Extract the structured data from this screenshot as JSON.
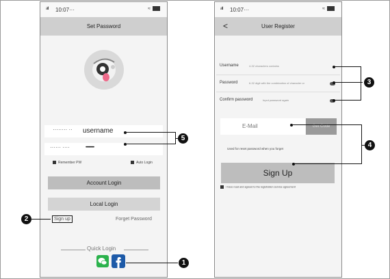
{
  "left_screen": {
    "status": {
      "signal": "atl",
      "time": "10:07···",
      "icons": "≈"
    },
    "title": "Set Password",
    "username_dots": "········ ··",
    "username": "username",
    "password_dots": "······ ····",
    "password_value": "•••••••••••",
    "remember_pw": "Remember PW",
    "auto_login": "Auto Login",
    "account_login": "Account Login",
    "local_login": "Local Login",
    "sign_up": "Sign up",
    "forget_password": "Forget Password",
    "quick_login": "Quick Login",
    "wechat_icon_name": "wechat-icon",
    "facebook_icon_name": "facebook-icon"
  },
  "right_screen": {
    "status": {
      "signal": "atl",
      "time": "10:07···",
      "icons": "≈"
    },
    "back": "<",
    "title": "User Register",
    "username_label": "Username",
    "username_ph": "4-32 characters contains",
    "password_label": "Password",
    "password_ph": "6-32 digit with the combination of character or",
    "confirm_label": "Confirm password",
    "confirm_ph": "Input password again",
    "email_placeholder": "E-Mail",
    "get_code": "Get Code",
    "email_hint": "Used for reset password when you forget",
    "sign_up": "Sign Up",
    "agreement": "I have read and agreed to the registration service agreement"
  },
  "markers": {
    "m1": "1",
    "m2": "2",
    "m3": "3",
    "m4": "4",
    "m5": "5"
  }
}
